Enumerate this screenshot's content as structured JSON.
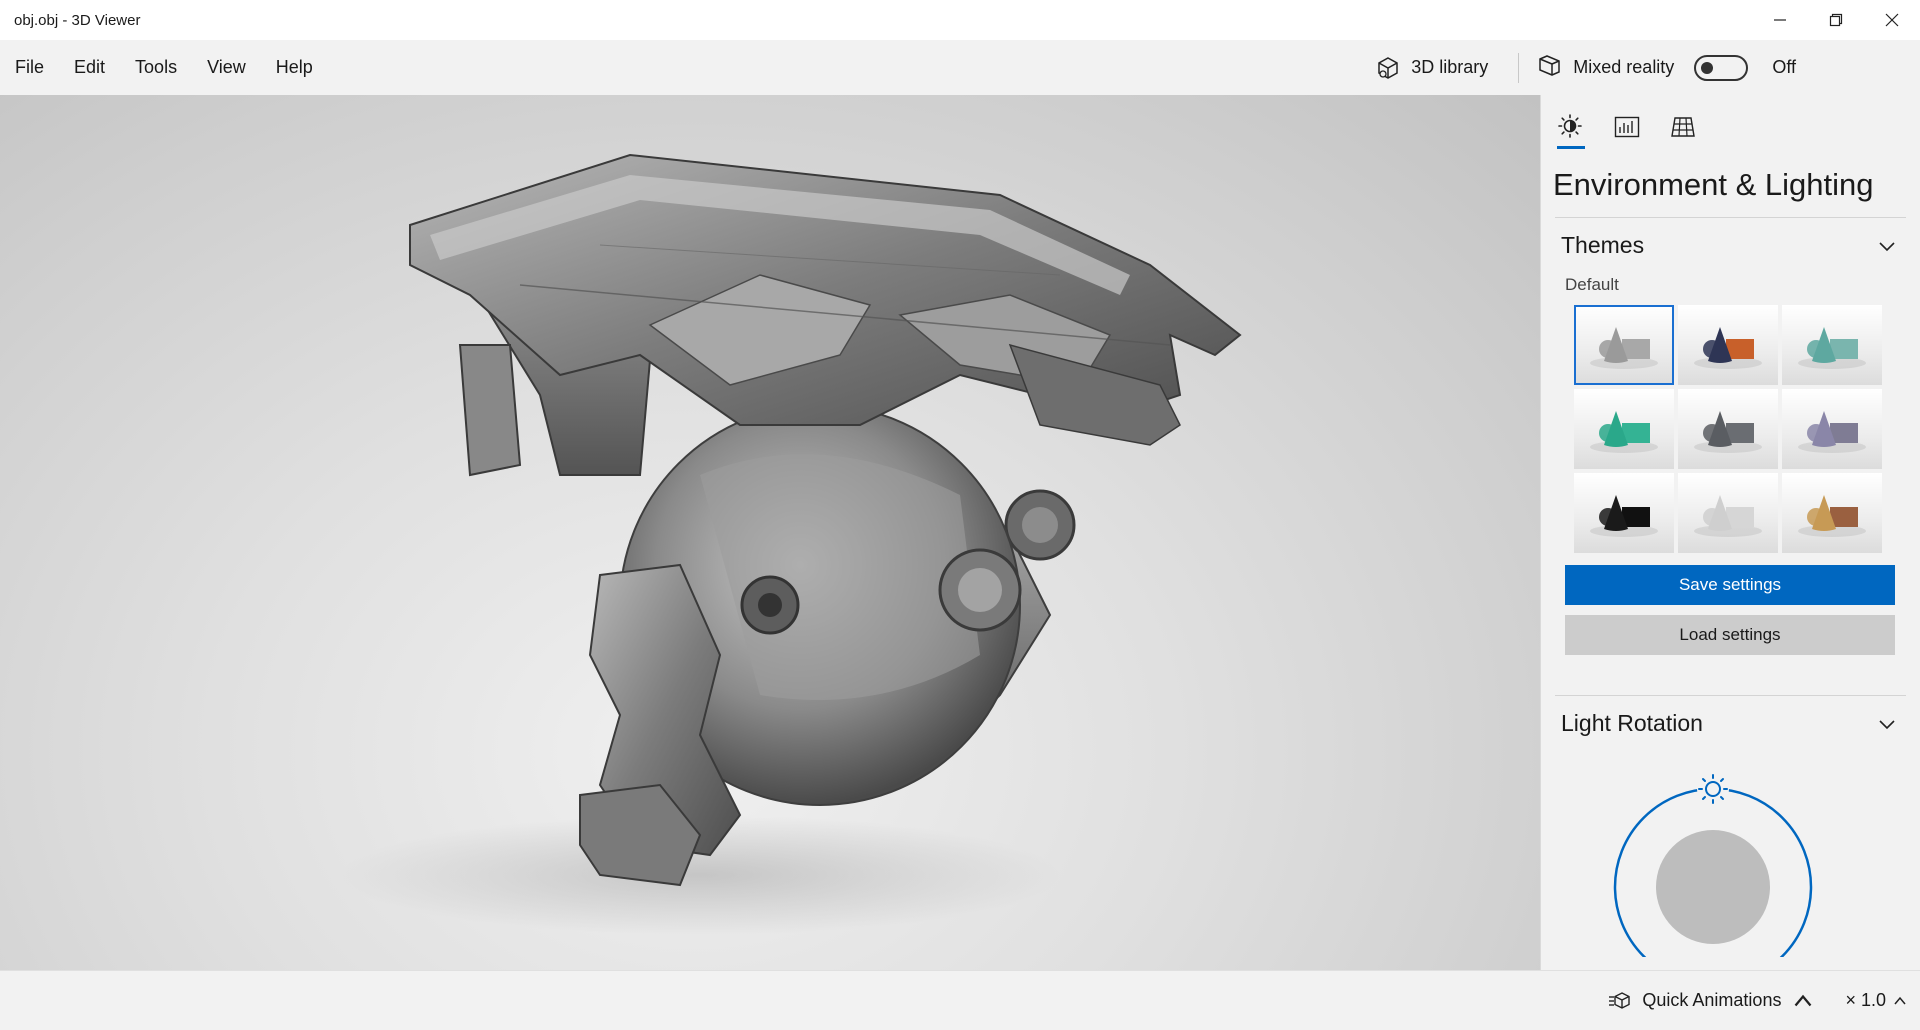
{
  "window": {
    "title": "obj.obj - 3D Viewer"
  },
  "menu": {
    "items": [
      "File",
      "Edit",
      "Tools",
      "View",
      "Help"
    ],
    "library_label": "3D library",
    "mixed_reality_label": "Mixed reality",
    "mixed_reality_state": "Off"
  },
  "panel": {
    "tabs": [
      {
        "icon": "sun-lighting-icon",
        "active": true
      },
      {
        "icon": "stats-icon",
        "active": false
      },
      {
        "icon": "grid-icon",
        "active": false
      }
    ],
    "title": "Environment & Lighting",
    "themes": {
      "header": "Themes",
      "selected_label": "Default",
      "swatches": [
        {
          "colors": [
            "#9a9a9a",
            "#a8a8a8"
          ],
          "selected": true
        },
        {
          "colors": [
            "#2e3555",
            "#c8602a"
          ],
          "selected": false
        },
        {
          "colors": [
            "#5ea8a0",
            "#7ab5ae"
          ],
          "selected": false
        },
        {
          "colors": [
            "#2aa88a",
            "#34b394"
          ],
          "selected": false
        },
        {
          "colors": [
            "#5a5d62",
            "#6a6d72"
          ],
          "selected": false
        },
        {
          "colors": [
            "#8a86a8",
            "#7f7c94"
          ],
          "selected": false
        },
        {
          "colors": [
            "#1a1a1a",
            "#111111"
          ],
          "selected": false
        },
        {
          "colors": [
            "#cfcfcf",
            "#d6d6d6"
          ],
          "selected": false
        },
        {
          "colors": [
            "#c79a55",
            "#9a6040"
          ],
          "selected": false
        }
      ],
      "save_label": "Save settings",
      "load_label": "Load settings"
    },
    "light_rotation": {
      "header": "Light Rotation"
    }
  },
  "statusbar": {
    "quick_animations_label": "Quick Animations",
    "speed_label": "× 1.0"
  },
  "colors": {
    "accent": "#0067c0",
    "panel_bg": "#f2f2f2"
  }
}
